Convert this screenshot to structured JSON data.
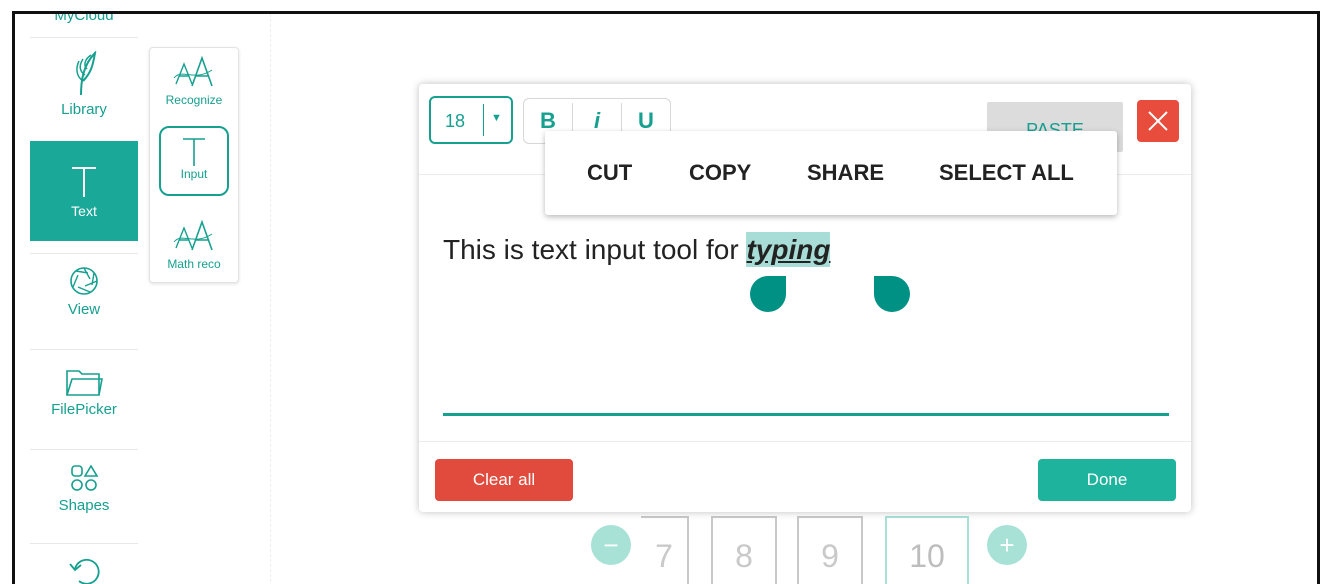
{
  "sidebar": {
    "top_cut_label": "MyCloud",
    "items": [
      {
        "label": "Library",
        "icon": "feather-icon"
      },
      {
        "label": "Text",
        "icon": "text-t-icon"
      },
      {
        "label": "View",
        "icon": "aperture-icon"
      },
      {
        "label": "FilePicker",
        "icon": "folder-icon"
      },
      {
        "label": "Shapes",
        "icon": "shapes-icon"
      }
    ]
  },
  "subtoolbar": {
    "items": [
      {
        "label": "Recognize",
        "icon": "handwriting-aa-icon"
      },
      {
        "label": "Input",
        "icon": "text-t-icon"
      },
      {
        "label": "Math reco",
        "icon": "handwriting-aa-icon"
      }
    ]
  },
  "dialog": {
    "font_size": "18",
    "bold_label": "B",
    "italic_label": "i",
    "underline_label": "U",
    "paste_label": "PASTE",
    "editor_text_before": "This is text input tool for ",
    "editor_text_selected": "typing",
    "clear_label": "Clear all",
    "done_label": "Done"
  },
  "context_menu": {
    "cut": "CUT",
    "copy": "COPY",
    "share": "SHARE",
    "select_all": "SELECT ALL"
  },
  "pager": {
    "pages": [
      "7",
      "8",
      "9",
      "10"
    ],
    "current": "10"
  },
  "colors": {
    "accent": "#16a08f",
    "danger": "#e04b3d"
  }
}
